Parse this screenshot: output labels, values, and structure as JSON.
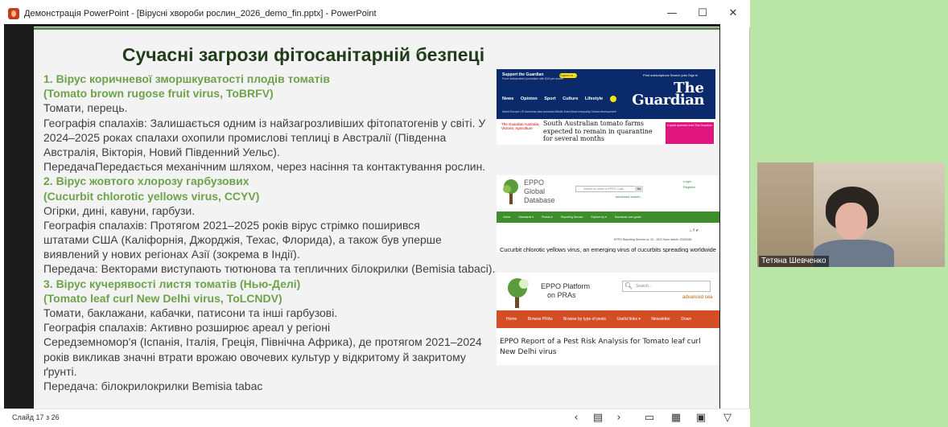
{
  "window": {
    "title": "Демонстрація PowerPoint - [Вірусні хвороби рослин_2026_demo_fin.pptx] - PowerPoint",
    "min_icon": "minimize-icon",
    "max_icon": "maximize-icon",
    "close_icon": "close-icon"
  },
  "slide": {
    "title": "Сучасні загрози фітосанітарній безпеці",
    "lines": [
      {
        "text": "1.     Вірус коричневої зморшкуватості плодів томатів",
        "style": "h"
      },
      {
        "text": "(Tomato brown rugose fruit virus, ToBRFV)",
        "style": "h"
      },
      {
        "text": "Томати, перець.",
        "style": ""
      },
      {
        "text": "Географія спалахів: Залишається одним із найзагрозливіших фітопатогенів у світі. У",
        "style": ""
      },
      {
        "text": "2024–2025 роках спалахи охопили промислові теплиці в Австралії (Південна",
        "style": ""
      },
      {
        "text": "Австралія, Вікторія, Новий Південний Уельс).",
        "style": ""
      },
      {
        "text": "ПередачаПередається механічним шляхом, через насіння та контактування рослин.",
        "style": ""
      },
      {
        "text": "2. Вірус жовтого хлорозу гарбузових",
        "style": "h"
      },
      {
        "text": "(Cucurbit chlorotic yellows virus, CCYV)",
        "style": "h"
      },
      {
        "text": "Огірки, дині, кавуни, гарбузи.",
        "style": ""
      },
      {
        "text": "Географія спалахів: Протягом 2021–2025 років вірус стрімко поширився",
        "style": ""
      },
      {
        "text": "штатами США (Каліфорнія, Джорджія, Техас, Флорида), а також був уперше",
        "style": ""
      },
      {
        "text": "виявлений у нових регіонах Азії (зокрема в Індії).",
        "style": ""
      },
      {
        "text": "Передача: Векторами виступають тютюнова та тепличних білокрилки (Bemisia tabaci).",
        "style": ""
      },
      {
        "text": "3. Вірус кучерявості листя томатів (Нью-Делі)",
        "style": "h"
      },
      {
        "text": "(Tomato leaf curl New Delhi virus, ToLCNDV)",
        "style": "h"
      },
      {
        "text": "Томати, баклажани, кабачки, патисони та інші гарбузові.",
        "style": ""
      },
      {
        "text": "Географія спалахів: Активно розширює ареал у регіоні",
        "style": ""
      },
      {
        "text": "Середземномор'я (Іспанія, Італія, Греція, Північна Африка), де протягом 2021–2024",
        "style": ""
      },
      {
        "text": "років викликав значні втрати врожаю овочевих культур у відкритому й закритому",
        "style": ""
      },
      {
        "text": "ґрунті.",
        "style": ""
      },
      {
        "text": "Передача: білокрилокрилки Bemisia tabac",
        "style": ""
      }
    ]
  },
  "guardian": {
    "support": "Support the Guardian",
    "support_sub": "Fund independent journalism with $15 per month",
    "support_btn": "Support us →",
    "links": "Print subscriptions   Search jobs   Sign in",
    "logo_the": "The",
    "logo": "Guardian",
    "nav": [
      "News",
      "Opinion",
      "Sport",
      "Culture",
      "Lifestyle"
    ],
    "sub_nav": "World  Europe  US  Americas  Asia  Australia  Middle East  Africa  Inequality  Global development",
    "left_text": "The Guardian Australia, Victoria, Agriculture",
    "headline": "South Australian tomato farms expected to remain in quarantine for several months",
    "ad_text": "A quick question from The Guardian"
  },
  "eppo_gd": {
    "title_lines": [
      "EPPO",
      "Global",
      "Database"
    ],
    "search_placeholder": "Search by name or EPPO Code...",
    "go": "Go",
    "advanced": "advanced search...",
    "login": "Login",
    "register": "Register",
    "nav": [
      "Home",
      "Standards ▾",
      "Photos ▾",
      "Reporting Service",
      "Explore by ▾",
      "Download user guide"
    ],
    "social": "⌂  f  ✔",
    "meta": "EPPO Reporting Service no. 02 - 2022  Num. article: 2022/045",
    "article": "Cucurbit chlorotic yellows virus, an emerging virus of cucurbits spreading worldwide"
  },
  "eppo_pra": {
    "title_lines": [
      "EPPO Platform",
      "on PRAs"
    ],
    "search_placeholder": "Search...",
    "advanced": "advanced sea",
    "nav": [
      "Home",
      "Browse PRAs",
      "Browse by type of pests",
      "Useful links ▾",
      "Newsletter",
      "Down"
    ],
    "report": "EPPO Report of a Pest Risk Analysis for Tomato leaf curl New Delhi virus"
  },
  "statusbar": {
    "slide_number": "Слайд 17 з 26",
    "buttons": [
      "‹",
      "▤",
      "›",
      "▭",
      "▦",
      "▣",
      "▽"
    ]
  },
  "camera": {
    "name": "Тетяна Шевченко"
  },
  "colors": {
    "heading_green": "#6da34a",
    "title_green": "#1f3d18",
    "eppo_green": "#3f8e2c",
    "eppo_orange": "#d34e24",
    "guardian_blue": "#0a2a6b",
    "desktop_bg": "#b9e6a6"
  }
}
